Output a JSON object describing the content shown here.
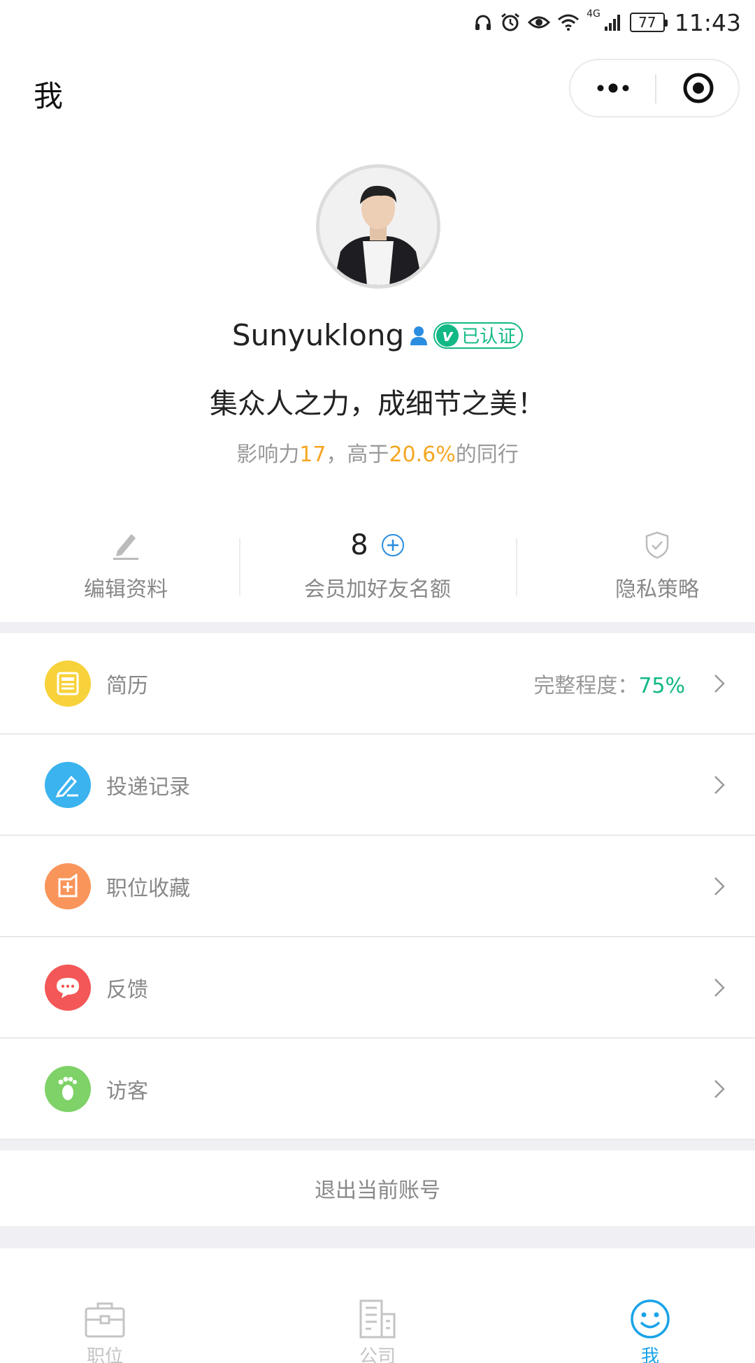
{
  "status_bar": {
    "battery": "77",
    "network": "4G",
    "time": "11:43"
  },
  "header": {
    "title": "我"
  },
  "profile": {
    "name": "Sunyuklong",
    "verified_label": "已认证",
    "verified_badge_letter": "v",
    "motto": "集众人之力，成细节之美！",
    "influence": {
      "prefix": "影响力",
      "score": "17",
      "middle": "，高于",
      "percent": "20.6%",
      "suffix": "的同行"
    }
  },
  "quick_actions": {
    "edit_label": "编辑资料",
    "member_count": "8",
    "member_label": "会员加好友名额",
    "privacy_label": "隐私策略"
  },
  "menu": {
    "items": [
      {
        "label": "简历",
        "icon": "resume-icon",
        "color": "#f7d23a",
        "extra_prefix": "完整程度：",
        "extra_value": "75%"
      },
      {
        "label": "投递记录",
        "icon": "delivery-record-icon",
        "color": "#3ab3ef"
      },
      {
        "label": "职位收藏",
        "icon": "favorite-job-icon",
        "color": "#f9955a"
      },
      {
        "label": "反馈",
        "icon": "feedback-icon",
        "color": "#f35757"
      },
      {
        "label": "访客",
        "icon": "visitor-footprint-icon",
        "color": "#7ed267"
      }
    ]
  },
  "logout_label": "退出当前账号",
  "tab_bar": {
    "tabs": [
      {
        "label": "职位",
        "icon": "briefcase-icon",
        "active": false
      },
      {
        "label": "公司",
        "icon": "building-icon",
        "active": false
      },
      {
        "label": "我",
        "icon": "smiley-icon",
        "active": true
      }
    ]
  },
  "colors": {
    "accent_green": "#12b886",
    "accent_orange": "#f5a623",
    "accent_blue": "#1aa3e8",
    "band_gray": "#efeff4"
  }
}
